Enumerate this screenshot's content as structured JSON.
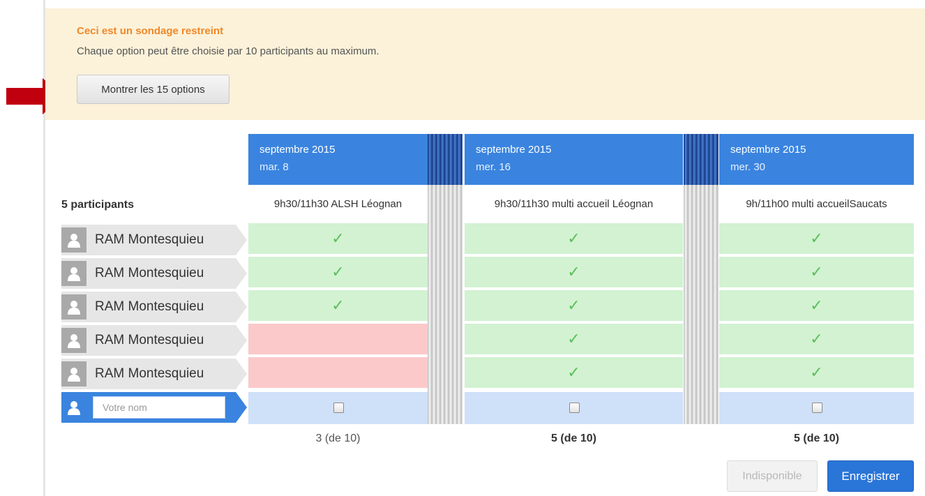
{
  "notice": {
    "title": "Ceci est un sondage restreint",
    "text": "Chaque option peut être choisie par 10 participants au maximum.",
    "show_button": "Montrer les 15 options"
  },
  "participants_label": "5 participants",
  "columns": [
    {
      "month": "septembre 2015",
      "day": "mar. 8",
      "option": "9h30/11h30 ALSH Léognan",
      "count": "3 (de 10)"
    },
    {
      "month": "septembre 2015",
      "day": "mer. 16",
      "option": "9h30/11h30 multi accueil Léognan",
      "count": "5 (de 10)"
    },
    {
      "month": "septembre 2015",
      "day": "mer. 30",
      "option": "9h/11h00 multi accueilSaucats",
      "count": "5 (de 10)"
    }
  ],
  "participants": [
    {
      "name": "RAM Montesquieu",
      "votes": [
        "yes",
        "yes",
        "yes"
      ]
    },
    {
      "name": "RAM Montesquieu",
      "votes": [
        "yes",
        "yes",
        "yes"
      ]
    },
    {
      "name": "RAM Montesquieu",
      "votes": [
        "yes",
        "yes",
        "yes"
      ]
    },
    {
      "name": "RAM Montesquieu",
      "votes": [
        "no",
        "yes",
        "yes"
      ]
    },
    {
      "name": "RAM Montesquieu",
      "votes": [
        "no",
        "yes",
        "yes"
      ]
    }
  ],
  "checkmark": "✓",
  "new_entry": {
    "placeholder": "Votre nom"
  },
  "actions": {
    "unavailable": "Indisponible",
    "save": "Enregistrer"
  },
  "colors": {
    "header_blue": "#3a84df",
    "yes_green": "#d2f2d2",
    "no_red": "#fbc9c9",
    "notice_bg": "#fcf2d9",
    "notice_title": "#f0882a",
    "arrow_red": "#c0000f"
  }
}
